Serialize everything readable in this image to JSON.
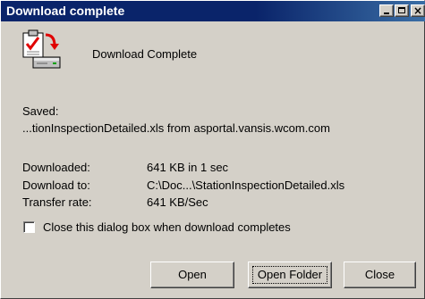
{
  "window": {
    "title": "Download complete",
    "controls": {
      "minimize": "minimize-icon",
      "maximize": "maximize-icon",
      "close": "close-icon",
      "close_glyph": "×"
    }
  },
  "header": {
    "icon": "download-complete-icon",
    "text": "Download Complete"
  },
  "saved": {
    "label": "Saved:",
    "value": "...tionInspectionDetailed.xls from asportal.vansis.wcom.com"
  },
  "details": [
    {
      "label": "Downloaded:",
      "value": "641 KB in 1 sec"
    },
    {
      "label": "Download to:",
      "value": "C:\\Doc...\\StationInspectionDetailed.xls"
    },
    {
      "label": "Transfer rate:",
      "value": "641 KB/Sec"
    }
  ],
  "close_on_complete": {
    "label": "Close this dialog box when download completes",
    "checked": false
  },
  "buttons": {
    "open": "Open",
    "open_folder": "Open Folder",
    "close": "Close"
  },
  "colors": {
    "titlebar": "#0a246a",
    "face": "#d4d0c8"
  }
}
